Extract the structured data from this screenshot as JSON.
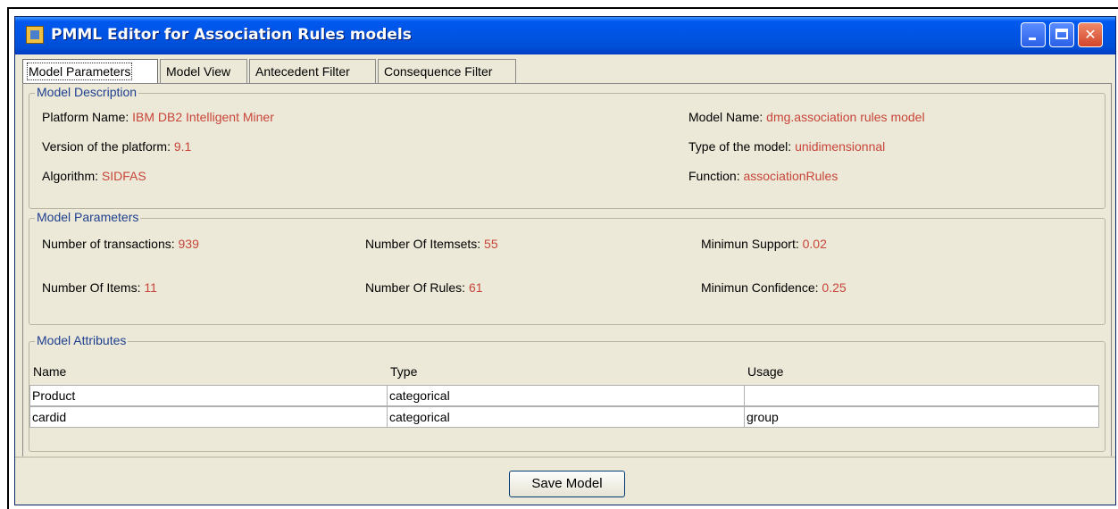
{
  "window": {
    "title": "PMML Editor for Association Rules models"
  },
  "tabs": [
    {
      "label": "Model Parameters"
    },
    {
      "label": "Model View"
    },
    {
      "label": "Antecedent Filter"
    },
    {
      "label": "Consequence Filter"
    }
  ],
  "model_description": {
    "legend": "Model Description",
    "platform_name_label": "Platform Name: ",
    "platform_name": "IBM DB2 Intelligent Miner",
    "version_label": "Version of the platform: ",
    "version": "9.1",
    "algorithm_label": "Algorithm: ",
    "algorithm": "SIDFAS",
    "model_name_label": "Model Name: ",
    "model_name": "dmg.association rules model",
    "model_type_label": "Type of the model: ",
    "model_type": "unidimensionnal",
    "function_label": "Function: ",
    "function": "associationRules"
  },
  "model_parameters": {
    "legend": "Model Parameters",
    "transactions_label": "Number of transactions: ",
    "transactions": "939",
    "itemsets_label": "Number Of Itemsets: ",
    "itemsets": "55",
    "min_support_label": "Minimun Support: ",
    "min_support": "0.02",
    "items_label": "Number Of Items: ",
    "items": "11",
    "rules_label": "Number Of Rules: ",
    "rules": "61",
    "min_confidence_label": "Minimun Confidence: ",
    "min_confidence": "0.25"
  },
  "model_attributes": {
    "legend": "Model Attributes",
    "columns": [
      "Name",
      "Type",
      "Usage"
    ],
    "rows": [
      {
        "name": "Product",
        "type": "categorical",
        "usage": ""
      },
      {
        "name": "cardid",
        "type": "categorical",
        "usage": "group"
      }
    ]
  },
  "footer": {
    "save_label": "Save Model"
  },
  "colors": {
    "title_bar": "#0054e3",
    "value_text": "#c8453a",
    "legend_text": "#1f3f8f",
    "window_bg": "#ece9d8"
  }
}
